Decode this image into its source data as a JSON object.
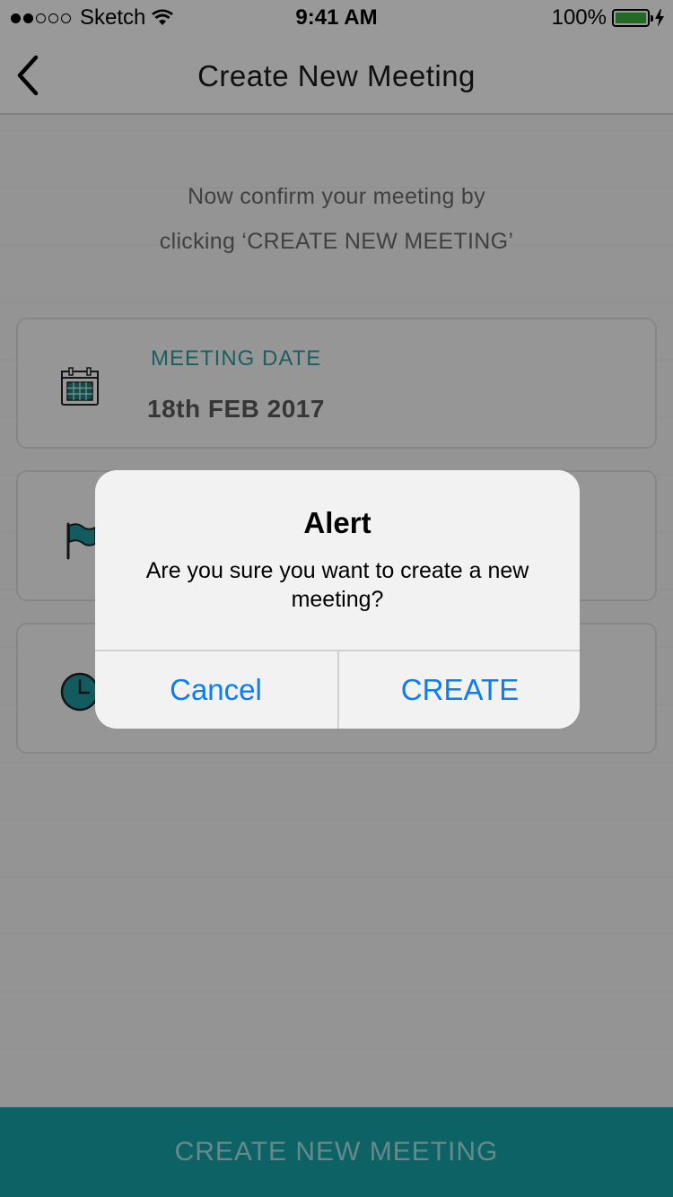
{
  "status_bar": {
    "carrier": "Sketch",
    "time": "9:41 AM",
    "battery_percent": "100%"
  },
  "nav": {
    "title": "Create New Meeting"
  },
  "instruction": {
    "line1": "Now confirm your meeting by",
    "line2": "clicking ‘CREATE NEW MEETING’"
  },
  "cards": [
    {
      "icon": "calendar-icon",
      "label": "MEETING DATE",
      "value": "18th FEB 2017"
    },
    {
      "icon": "flag-icon",
      "label": "",
      "value": ""
    },
    {
      "icon": "clock-icon",
      "label": "",
      "value": ""
    }
  ],
  "bottom_bar": {
    "label": "CREATE NEW MEETING"
  },
  "alert": {
    "title": "Alert",
    "message": "Are you sure you want to create a new meeting?",
    "cancel_label": "Cancel",
    "confirm_label": "CREATE"
  },
  "colors": {
    "accent": "#14a3a8",
    "label_teal": "#2f9ea0",
    "ios_blue": "#0a7cf5",
    "battery_green": "#3cb13c"
  }
}
